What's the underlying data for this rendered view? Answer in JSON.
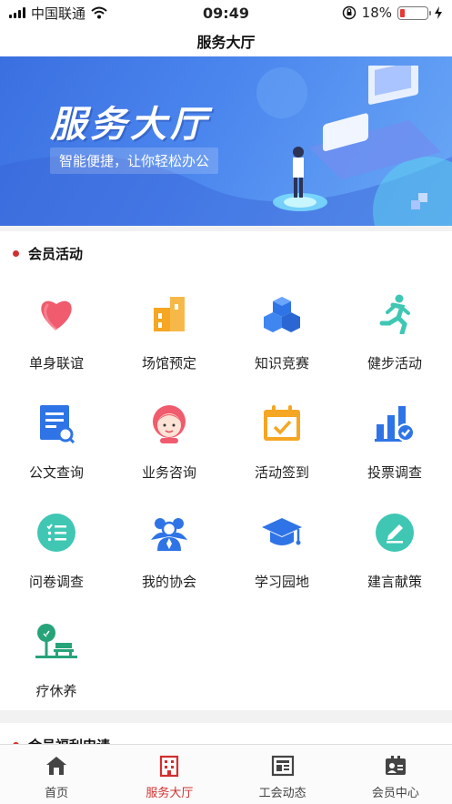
{
  "status_bar": {
    "carrier": "中国联通",
    "time": "09:49",
    "battery": "18%",
    "battery_level": 0.18
  },
  "nav": {
    "title": "服务大厅"
  },
  "banner": {
    "title": "服务大厅",
    "subtitle": "智能便捷，让你轻松办公"
  },
  "section_member": {
    "title": "会员活动",
    "items": [
      {
        "label": "单身联谊",
        "icon": "heart-icon"
      },
      {
        "label": "场馆预定",
        "icon": "building-icon"
      },
      {
        "label": "知识竞赛",
        "icon": "cubes-icon"
      },
      {
        "label": "健步活动",
        "icon": "runner-icon"
      },
      {
        "label": "公文查询",
        "icon": "document-search-icon"
      },
      {
        "label": "业务咨询",
        "icon": "customer-service-icon"
      },
      {
        "label": "活动签到",
        "icon": "calendar-check-icon"
      },
      {
        "label": "投票调查",
        "icon": "bar-chart-check-icon"
      },
      {
        "label": "问卷调查",
        "icon": "checklist-icon"
      },
      {
        "label": "我的协会",
        "icon": "group-icon"
      },
      {
        "label": "学习园地",
        "icon": "graduation-cap-icon"
      },
      {
        "label": "建言献策",
        "icon": "pencil-icon"
      },
      {
        "label": "疗休养",
        "icon": "tree-bench-icon"
      }
    ]
  },
  "section_welfare": {
    "title": "会员福利申请"
  },
  "tabbar": {
    "items": [
      {
        "label": "首页",
        "icon": "home-icon"
      },
      {
        "label": "服务大厅",
        "icon": "office-building-icon"
      },
      {
        "label": "工会动态",
        "icon": "news-icon"
      },
      {
        "label": "会员中心",
        "icon": "member-card-icon"
      }
    ],
    "active_index": 1
  },
  "colors": {
    "accent": "#d32f2f",
    "banner": "#4b86ee"
  }
}
